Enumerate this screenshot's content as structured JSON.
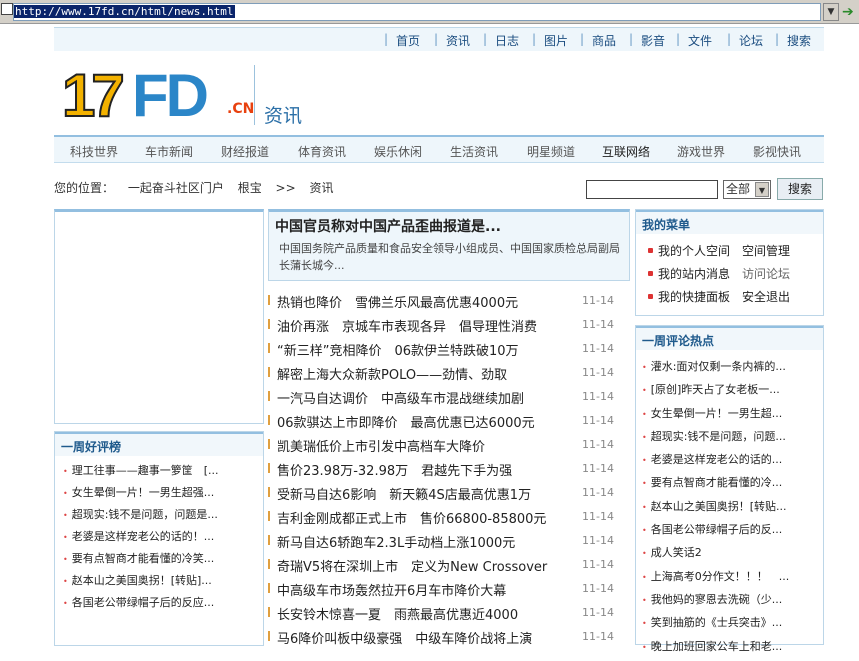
{
  "address_bar": {
    "url": "http://www.17fd.cn/html/news.html"
  },
  "top_nav": [
    "首页",
    "资讯",
    "日志",
    "图片",
    "商品",
    "影音",
    "文件",
    "论坛",
    "搜索"
  ],
  "logo": {
    "digits": "17",
    "letters": "FD",
    "suffix": ".CN",
    "section_title": "资讯"
  },
  "category_nav": [
    "科技世界",
    "车市新闻",
    "财经报道",
    "体育资讯",
    "娱乐休闲",
    "生活资讯",
    "明星频道",
    "互联网络",
    "游戏世界",
    "影视快讯"
  ],
  "breadcrumb": {
    "label": "您的位置：",
    "items": [
      "一起奋斗社区门户",
      "根宝",
      ">>",
      "资讯"
    ]
  },
  "search": {
    "select_value": "全部",
    "button_label": "搜索"
  },
  "headline": {
    "title": "中国官员称对中国产品歪曲报道是...",
    "summary": "中国国务院产品质量和食品安全领导小组成员、中国国家质检总局副局长蒲长城今..."
  },
  "news": [
    {
      "title": "热销也降价　雪佛兰乐风最高优惠4000元",
      "date": "11-14"
    },
    {
      "title": "油价再涨　京城车市表现各异　倡导理性消费",
      "date": "11-14"
    },
    {
      "title": "“新三样”竞相降价　06款伊兰特跌破10万",
      "date": "11-14"
    },
    {
      "title": "解密上海大众新款POLO——劲情、劲取",
      "date": "11-14"
    },
    {
      "title": "一汽马自达调价　中高级车市混战继续加剧",
      "date": "11-14"
    },
    {
      "title": "06款骐达上市即降价　最高优惠已达6000元",
      "date": "11-14"
    },
    {
      "title": "凯美瑞低价上市引发中高档车大降价",
      "date": "11-14"
    },
    {
      "title": "售价23.98万-32.98万　君越先下手为强",
      "date": "11-14"
    },
    {
      "title": "受新马自达6影响　新天籁4S店最高优惠1万",
      "date": "11-14"
    },
    {
      "title": "吉利金刚成都正式上市　售价66800-85800元",
      "date": "11-14"
    },
    {
      "title": "新马自达6轿跑车2.3L手动档上涨1000元",
      "date": "11-14"
    },
    {
      "title": "奇瑞V5将在深圳上市　定义为New Crossover",
      "date": "11-14"
    },
    {
      "title": "中高级车市场轰然拉开6月车市降价大幕",
      "date": "11-14"
    },
    {
      "title": "长安铃木惊喜一夏　雨燕最高优惠近4000",
      "date": "11-14"
    },
    {
      "title": "马6降价叫板中级豪强　中级车降价战将上演",
      "date": "11-14"
    }
  ],
  "left_review": {
    "title": "一周好评榜",
    "items": [
      "理工往事——趣事一箩筐　[...",
      "女生晕倒一片！一男生超强...",
      "超现实:钱不是问题，问题是...",
      "老婆是这样宠老公的话的！...",
      "要有点智商才能看懂的冷笑...",
      "赵本山之美国奥拐！[转贴]...",
      "各国老公带绿帽子后的反应..."
    ]
  },
  "my_menu": {
    "title": "我的菜单",
    "items": [
      [
        "我的个人空间",
        "空间管理"
      ],
      [
        "我的站内消息",
        "访问论坛"
      ],
      [
        "我的快捷面板",
        "安全退出"
      ]
    ]
  },
  "hot": {
    "title": "一周评论热点",
    "items": [
      "灌水:面对仅剩一条内裤的...",
      "[原创]昨天占了女老板一...",
      "女生晕倒一片！一男生超...",
      "超现实:钱不是问题，问题...",
      "老婆是这样宠老公的话的...",
      "要有点智商才能看懂的冷...",
      "赵本山之美国奥拐！[转贴...",
      "各国老公带绿帽子后的反...",
      "成人笑话2",
      "上海高考0分作文！！！　...",
      "我他妈的寥恩去洗碗（少...",
      "笑到抽筋的《士兵突击》...",
      "晚上加班回家公车上和老..."
    ]
  }
}
